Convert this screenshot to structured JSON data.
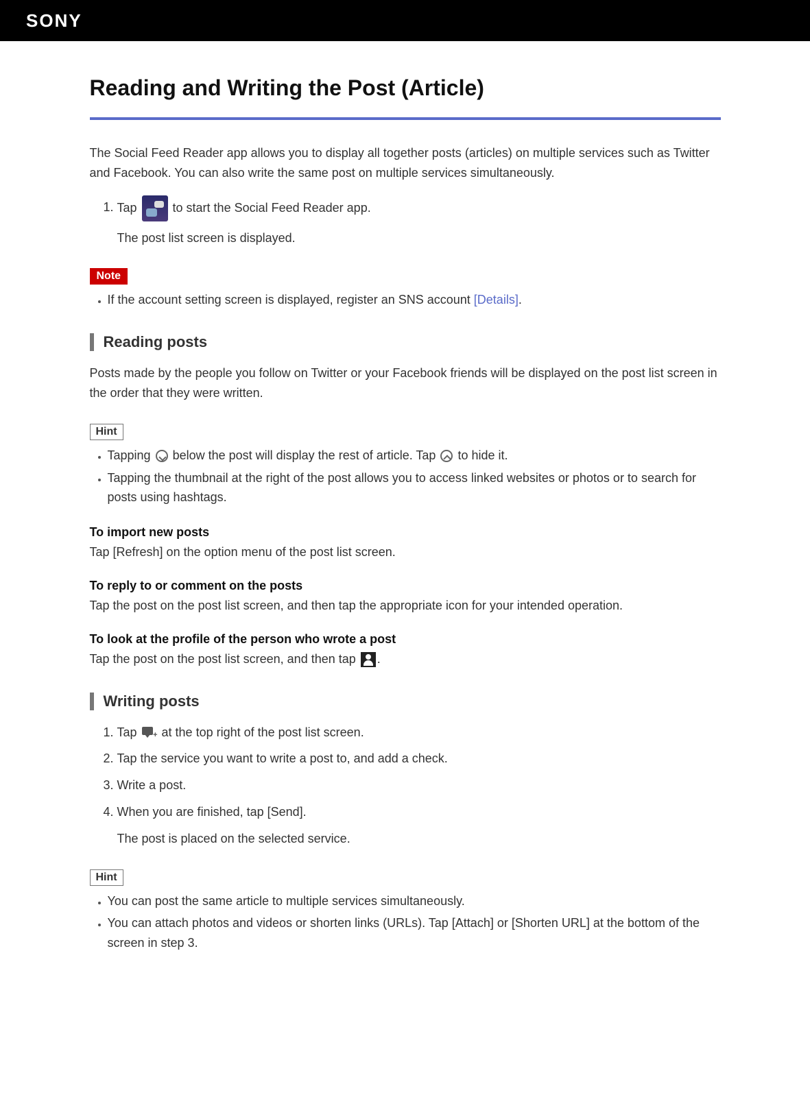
{
  "header": {
    "logo_text": "SONY"
  },
  "title": "Reading and Writing the Post (Article)",
  "intro": "The Social Feed Reader app allows you to display all together posts (articles) on multiple services such as Twitter and Facebook. You can also write the same post on multiple services simultaneously.",
  "step1_pre": "Tap ",
  "step1_post": " to start the Social Feed Reader app.",
  "step1_sub": "The post list screen is displayed.",
  "note_label": "Note",
  "note_item_pre": "If the account setting screen is displayed, register an SNS account ",
  "note_item_link": "[Details]",
  "note_item_post": ".",
  "reading": {
    "heading": "Reading posts",
    "para": "Posts made by the people you follow on Twitter or your Facebook friends will be displayed on the post list screen in the order that they were written.",
    "hint_label": "Hint",
    "hint1_a": "Tapping ",
    "hint1_b": " below the post will display the rest of article. Tap ",
    "hint1_c": " to hide it.",
    "hint2": "Tapping the thumbnail at the right of the post allows you to access linked websites or photos or to search for posts using hashtags.",
    "import_h": "To import new posts",
    "import_p": "Tap [Refresh] on the option menu of the post list screen.",
    "reply_h": "To reply to or comment on the posts",
    "reply_p": "Tap the post on the post list screen, and then tap the appropriate icon for your intended operation.",
    "profile_h": "To look at the profile of the person who wrote a post",
    "profile_p_pre": "Tap the post on the post list screen, and then tap ",
    "profile_p_post": "."
  },
  "writing": {
    "heading": "Writing posts",
    "step1_pre": "Tap ",
    "step1_post": " at the top right of the post list screen.",
    "step2": "Tap the service you want to write a post to, and add a check.",
    "step3": "Write a post.",
    "step4_a": "When you are finished, tap [Send].",
    "step4_b": "The post is placed on the selected service.",
    "hint_label": "Hint",
    "hint1": "You can post the same article to multiple services simultaneously.",
    "hint2": "You can attach photos and videos or shorten links (URLs). Tap [Attach] or [Shorten URL] at the bottom of the screen in step 3."
  }
}
